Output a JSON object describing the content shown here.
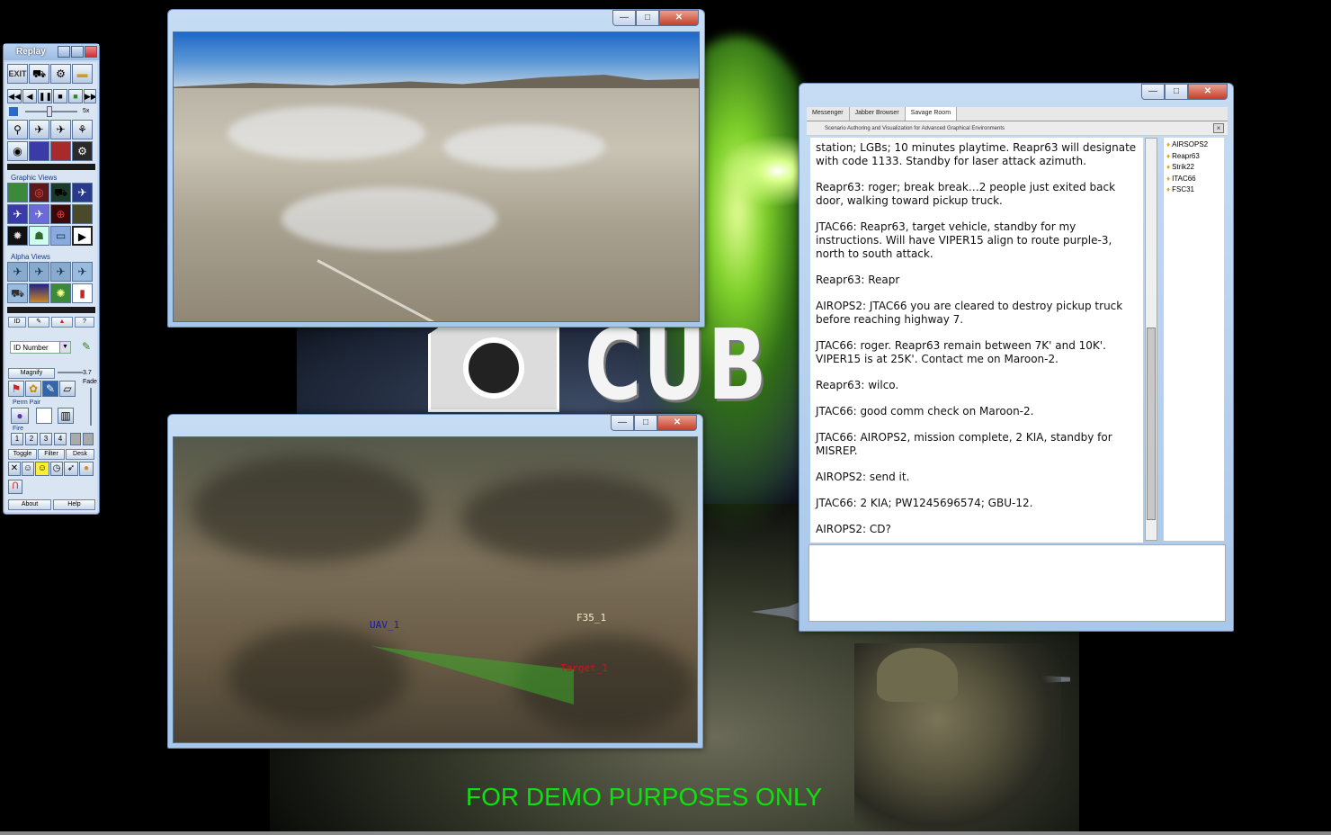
{
  "replay_panel": {
    "title": "Replay",
    "exit_label": "EXIT",
    "speed_label": "5x",
    "section_graphic": "Graphic Views",
    "section_alpha": "Alpha Views",
    "id_tab": "ID",
    "id_select": "ID Number",
    "magnify": "Magnify",
    "magnify_value": "3.7",
    "fade": "Fade",
    "perm_pair": "Perm Pair",
    "fire": "Fire",
    "fire_buttons": [
      "1",
      "2",
      "3",
      "4"
    ],
    "toggle": "Toggle",
    "filter": "Filter",
    "desk": "Desk",
    "about": "About",
    "help": "Help"
  },
  "map_window": {
    "labels": {
      "uav": "UAV_1",
      "f35": "F35_1",
      "target": "Target_1"
    },
    "colors": {
      "uav": "#1a1aa8",
      "f35": "#f2f0c8",
      "target": "#c81818"
    }
  },
  "chat_window": {
    "tabs": [
      "Messenger",
      "Jabber Browser",
      "Savage Room"
    ],
    "subtitle": "Scenario Authoring and Visualization for Advanced Graphical Environments",
    "messages": [
      "station; LGBs; 10 minutes playtime.  Reapr63 will designate with code 1133.  Standby for laser attack azimuth.",
      "Reapr63: roger; break break…2 people just exited back door, walking toward pickup truck.",
      "JTAC66: Reapr63, target vehicle, standby for my instructions. Will have VIPER15 align to route purple-3, north to south attack.",
      "Reapr63: Reapr",
      "AIROPS2: JTAC66 you are cleared to destroy pickup truck before reaching highway 7.",
      "JTAC66: roger.  Reapr63 remain between 7K' and 10K'. VIPER15 is at 25K'.  Contact me on Maroon-2.",
      "Reapr63: wilco.",
      "JTAC66: good comm check on Maroon-2.",
      "JTAC66: AIROPS2, mission complete, 2 KIA, standby for MISREP.",
      "AIROPS2: send it.",
      "JTAC66: 2 KIA; PW1245696574; GBU-12.",
      "AIROPS2: CD?"
    ],
    "roster": [
      "AIRSOPS2",
      "Reapr63",
      "Strik22",
      "ITAC66",
      "FSC31"
    ],
    "input_value": ""
  },
  "background": {
    "logo_text": "CUB",
    "demo_notice": "FOR DEMO PURPOSES ONLY",
    "demo_color": "#10e010"
  },
  "window_controls": {
    "minimize": "—",
    "maximize": "□",
    "close": "✕"
  }
}
